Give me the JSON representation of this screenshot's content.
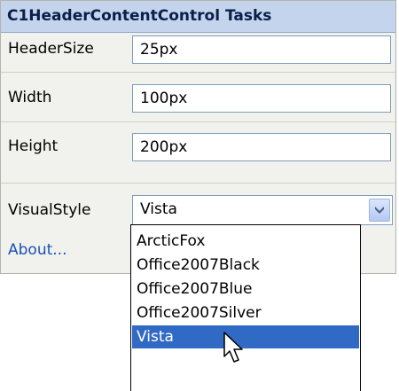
{
  "panel": {
    "title": "C1HeaderContentControl Tasks",
    "rows": [
      {
        "label": "HeaderSize",
        "value": "25px"
      },
      {
        "label": "Width",
        "value": "100px"
      },
      {
        "label": "Height",
        "value": "200px"
      }
    ],
    "visual_style": {
      "label": "VisualStyle",
      "selected": "Vista"
    },
    "about_link": "About..."
  },
  "dropdown": {
    "options": [
      "ArcticFox",
      "Office2007Black",
      "Office2007Blue",
      "Office2007Silver",
      "Vista"
    ],
    "highlighted": "Vista"
  },
  "colors": {
    "header_bg": "#c3d4ec",
    "panel_bg": "#f1f1ed",
    "link": "#1a52b8",
    "selection": "#316ac5"
  }
}
